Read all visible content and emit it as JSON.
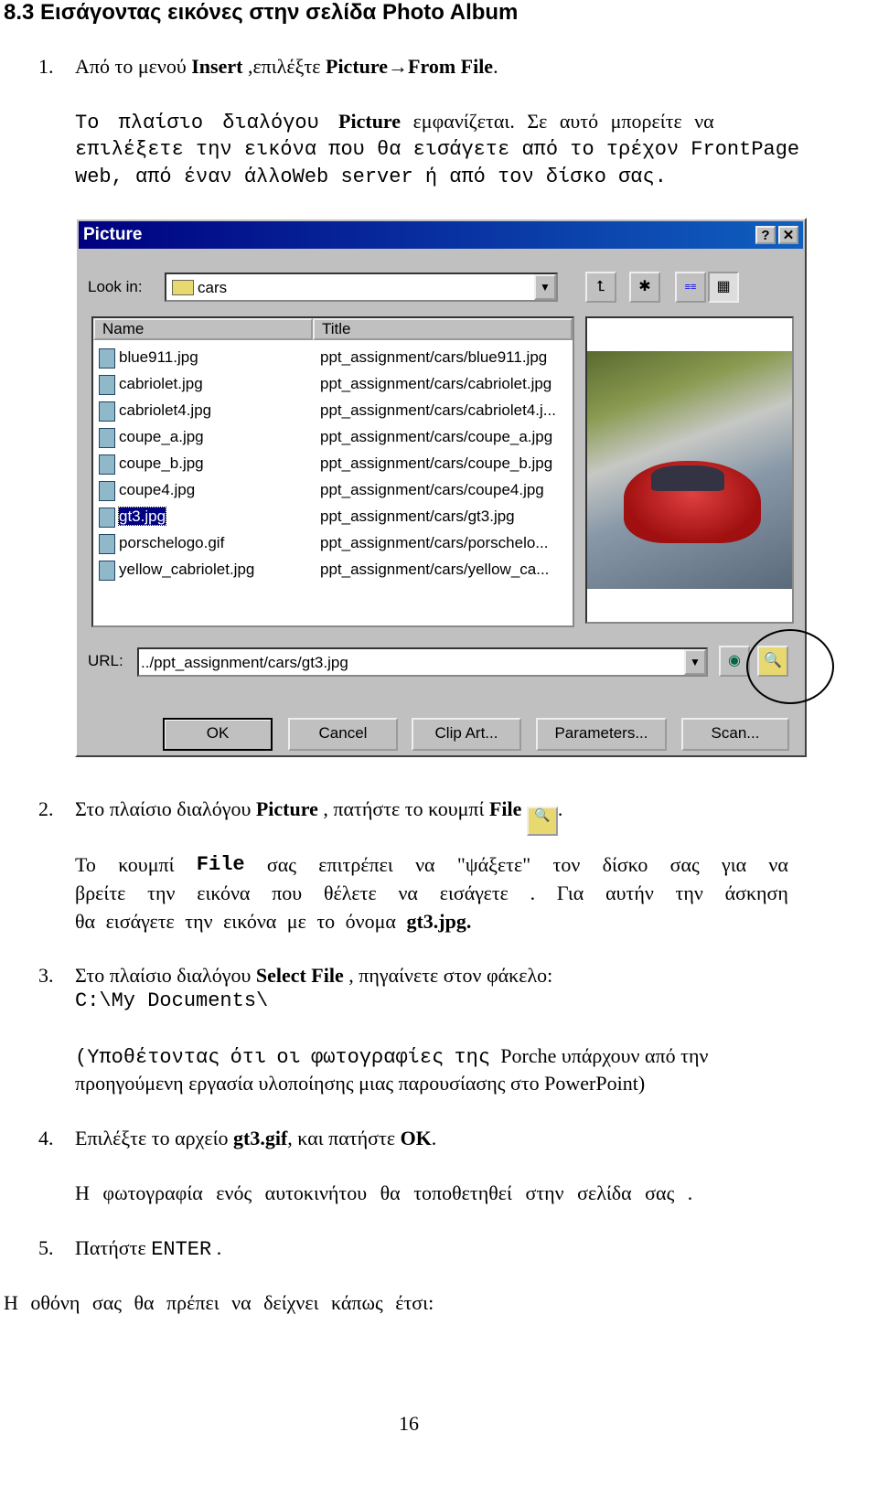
{
  "heading": "8.3   Εισάγοντας εικόνες στην σελίδα Photo Album",
  "step1": {
    "num": "1.",
    "pre": "Από το μενού ",
    "b1": "Insert",
    "mid": " ,επιλέξτε ",
    "b2": "Picture",
    "arrow": "→",
    "b3": "From File",
    "end": "."
  },
  "para1": {
    "l1a": "Το πλαίσιο διαλόγου ",
    "l1b": "Picture",
    "l1c": " εμφανίζεται. Σε αυτό μπορείτε να",
    "l2": "επιλέξετε την εικόνα που θα εισάγετε από το τρέχον FrontPage",
    "l3": "web, από έναν άλλοWeb server ή από τον δίσκο σας."
  },
  "dialog": {
    "title": "Picture",
    "help": "?",
    "close": "✕",
    "look_in_label": "Look in:",
    "look_in_value": "cars",
    "col_name": "Name",
    "col_title": "Title",
    "files": [
      {
        "name": "blue911.jpg",
        "title": "ppt_assignment/cars/blue911.jpg"
      },
      {
        "name": "cabriolet.jpg",
        "title": "ppt_assignment/cars/cabriolet.jpg"
      },
      {
        "name": "cabriolet4.jpg",
        "title": "ppt_assignment/cars/cabriolet4.j..."
      },
      {
        "name": "coupe_a.jpg",
        "title": "ppt_assignment/cars/coupe_a.jpg"
      },
      {
        "name": "coupe_b.jpg",
        "title": "ppt_assignment/cars/coupe_b.jpg"
      },
      {
        "name": "coupe4.jpg",
        "title": "ppt_assignment/cars/coupe4.jpg"
      },
      {
        "name": "gt3.jpg",
        "title": "ppt_assignment/cars/gt3.jpg",
        "selected": true
      },
      {
        "name": "porschelogo.gif",
        "title": "ppt_assignment/cars/porschelo..."
      },
      {
        "name": "yellow_cabriolet.jpg",
        "title": "ppt_assignment/cars/yellow_ca..."
      }
    ],
    "url_label": "URL:",
    "url_value": "../ppt_assignment/cars/gt3.jpg",
    "buttons": [
      "OK",
      "Cancel",
      "Clip Art...",
      "Parameters...",
      "Scan..."
    ]
  },
  "step2": {
    "num": "2.",
    "pre": "Στο πλαίσιο διαλόγου ",
    "b1": "Picture",
    "mid": " , πατήστε το κουμπί ",
    "b2": "File",
    "end": "."
  },
  "para2": {
    "l1": [
      "Το",
      "κουμπί",
      "File",
      "σας",
      "επιτρέπει",
      "να",
      "\"ψάξετε\"",
      "τον",
      "δίσκο",
      "σας",
      "για",
      "να"
    ],
    "l2": [
      "βρείτε",
      "την",
      "εικόνα",
      "που",
      "θέλετε",
      "να",
      "εισάγετε",
      ".",
      "Για",
      "αυτήν",
      "την",
      "άσκηση"
    ],
    "l3a": "θα εισάγετε την εικόνα με το όνομα ",
    "l3b": "gt3.jpg",
    "l3c": "."
  },
  "step3": {
    "num": "3.",
    "pre": "Στο πλαίσιο διαλόγου ",
    "b1": "Select File",
    "mid": " , πηγαίνετε στον φάκελο:",
    "path": "C:\\My Documents\\"
  },
  "para3": {
    "l1a": "(Υποθέτοντας ότι οι φωτογραφίες της ",
    "l1b": "Porche υπάρχουν από την",
    "l2": "προηγούμενη εργασία υλοποίησης μιας παρουσίασης στο PowerPoint)"
  },
  "step4": {
    "num": "4.",
    "pre": "Επιλέξτε το αρχείο ",
    "b1": "gt3.gif",
    "mid": ", και πατήστε ",
    "b2": "OK",
    "end": "."
  },
  "para4": "Η φωτογραφία ενός αυτοκινήτου θα τοποθετηθεί στην σελίδα σας .",
  "step5": {
    "num": "5.",
    "pre": "Πατήστε ",
    "code": "ENTER",
    "end": " ."
  },
  "final": "Η οθόνη σας θα πρέπει να δείχνει κάπως έτσι:",
  "page_number": "16"
}
